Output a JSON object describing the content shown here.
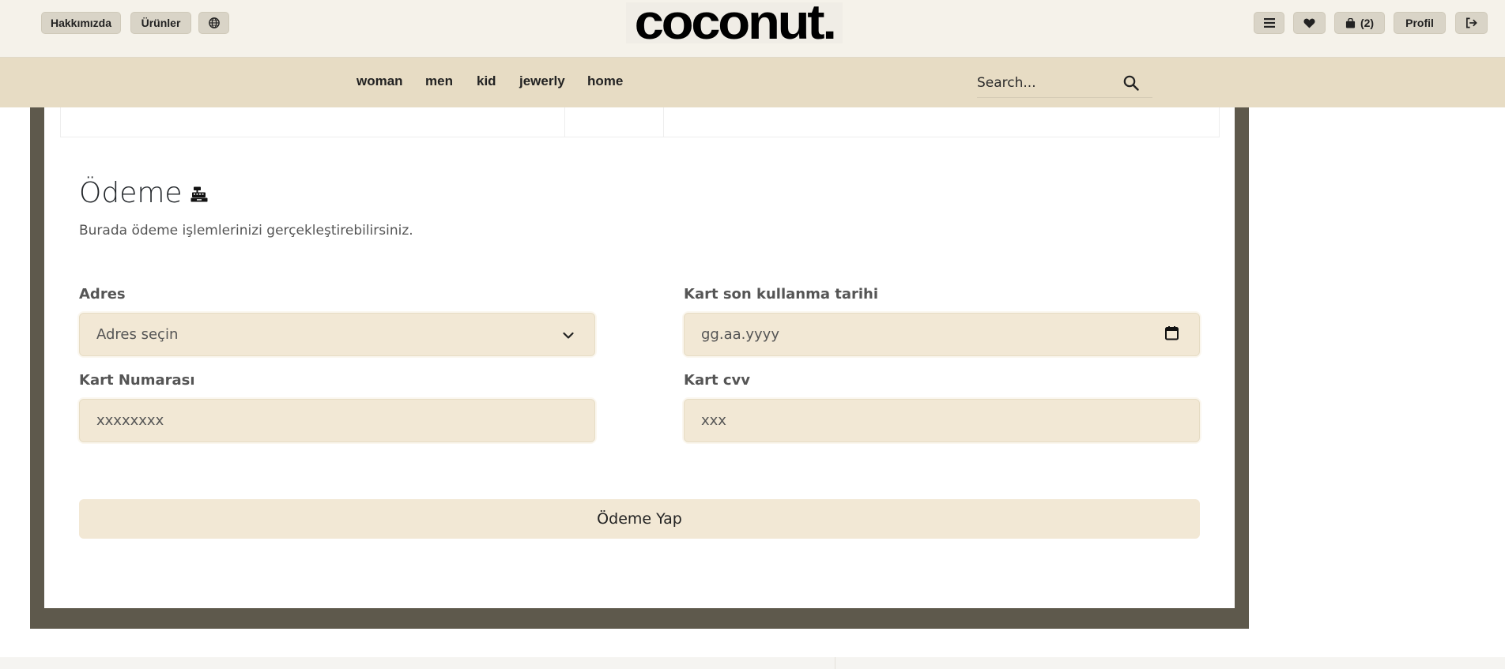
{
  "header": {
    "buttons": {
      "about": "Hakkımızda",
      "products": "Ürünler",
      "profile": "Profil",
      "cart_count": "(2)"
    },
    "logo_text": "coconut."
  },
  "nav": {
    "links": [
      "woman",
      "men",
      "kid",
      "jewerly",
      "home"
    ],
    "search_placeholder": "Search..."
  },
  "payment": {
    "title": "Ödeme",
    "subtitle": "Burada ödeme işlemlerinizi gerçekleştirebilirsiniz.",
    "fields": {
      "address_label": "Adres",
      "address_value": "Adres seçin",
      "expiry_label": "Kart son kullanma tarihi",
      "expiry_placeholder": "gg.aa.yyyy",
      "card_number_label": "Kart Numarası",
      "card_number_placeholder": "xxxxxxxx",
      "cvv_label": "Kart cvv",
      "cvv_placeholder": "xxx"
    },
    "submit_label": "Ödeme Yap"
  },
  "colors": {
    "topbar": "#f5f2ea",
    "navbar": "#e7dcc4",
    "frame": "#5e594c",
    "field": "#f2e8d5",
    "pill": "#d9d4c7"
  }
}
